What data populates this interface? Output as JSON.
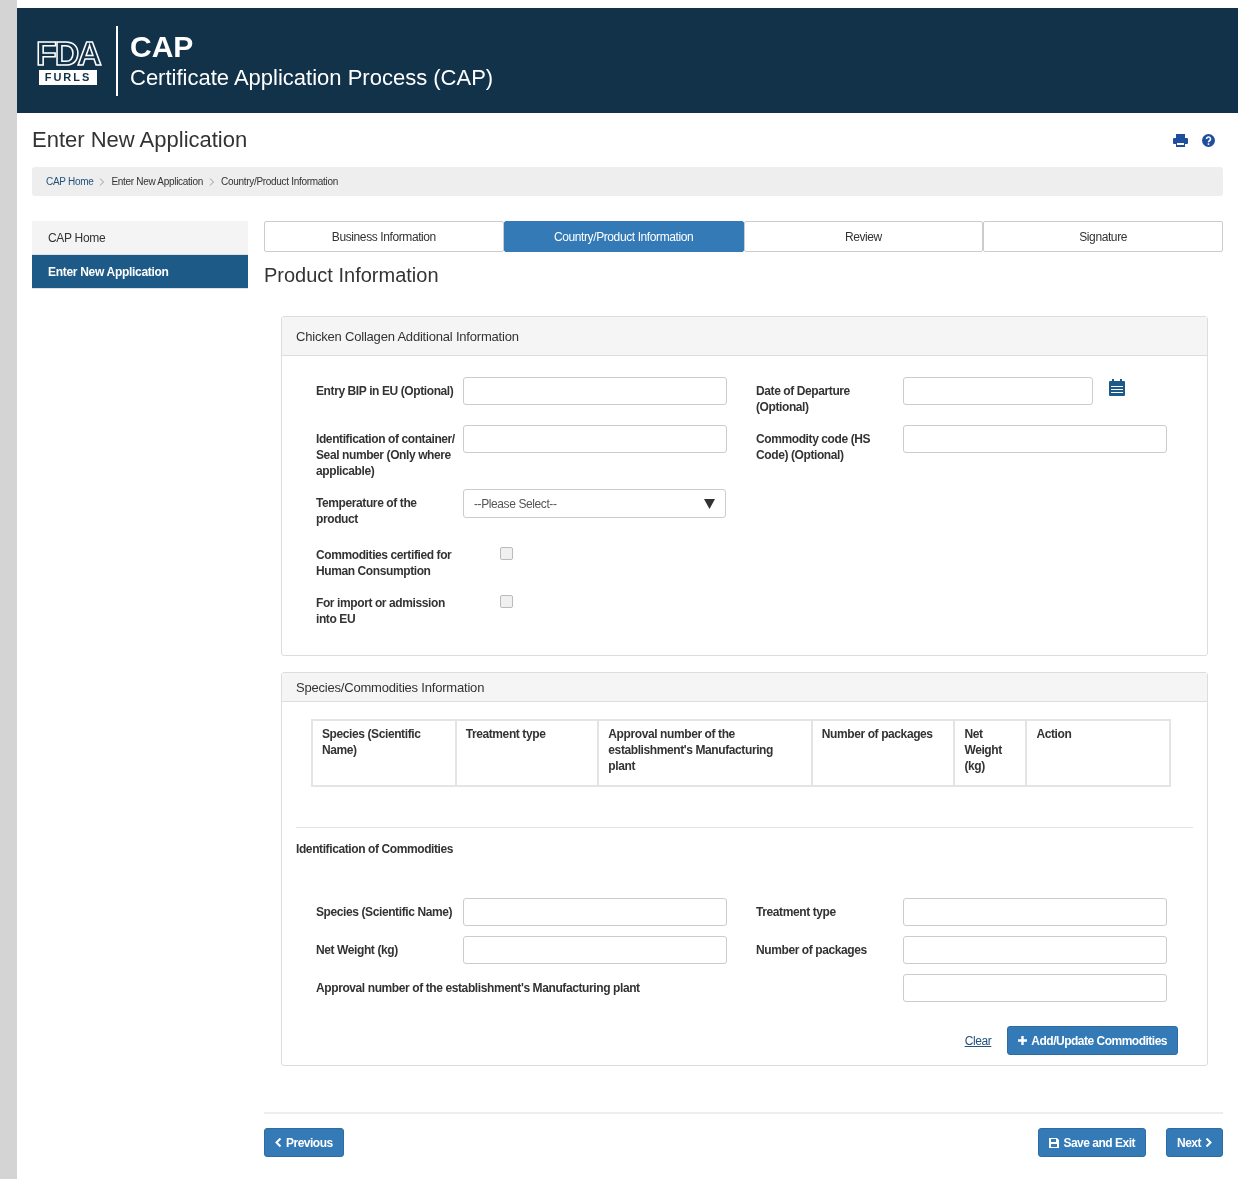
{
  "header": {
    "logo": {
      "top": "FDA",
      "bottom": "FURLS"
    },
    "title": "CAP",
    "subtitle": "Certificate Application Process (CAP)"
  },
  "page_title": "Enter New Application",
  "breadcrumb": [
    {
      "label": "CAP Home",
      "kind": "link"
    },
    {
      "label": "Enter New Application",
      "kind": "text"
    },
    {
      "label": "Country/Product Information",
      "kind": "text"
    }
  ],
  "sidebar": {
    "items": [
      {
        "label": "CAP Home",
        "selected": false
      },
      {
        "label": "Enter New Application",
        "selected": true
      }
    ]
  },
  "tabs": [
    {
      "label": "Business Information",
      "selected": false
    },
    {
      "label": "Country/Product Information",
      "selected": true
    },
    {
      "label": "Review",
      "selected": false
    },
    {
      "label": "Signature",
      "selected": false
    }
  ],
  "section_title": "Product Information",
  "additional_panel": {
    "title": "Chicken Collagen Additional Information",
    "rows": [
      [
        {
          "label": "Entry BIP in EU (Optional)",
          "kind": "text"
        },
        {
          "label": "Date of Departure (Optional)",
          "kind": "date"
        }
      ],
      [
        {
          "label": "Identification of container/  Seal number (Only where applicable)",
          "kind": "text"
        },
        {
          "label": "Commodity code (HS Code) (Optional)",
          "kind": "text"
        }
      ],
      [
        {
          "label": "Temperature of the product",
          "kind": "select",
          "value": "--Please Select--"
        }
      ],
      [
        {
          "label": "Commodities certified for Human Consumption",
          "kind": "checkbox",
          "checked": false
        }
      ],
      [
        {
          "label": "For import or admission into EU",
          "kind": "checkbox",
          "checked": false
        }
      ]
    ]
  },
  "commodities_panel": {
    "title": "Species/Commodities Information",
    "table": {
      "columns": [
        "Species (Scientific Name)",
        "Treatment type",
        "Approval number of the establishment's Manufacturing plant",
        "Number of packages",
        "Net Weight (kg)",
        "Action"
      ]
    },
    "subheading": "Identification of Commodities",
    "rows": [
      [
        {
          "label": "Species (Scientific Name)",
          "kind": "text"
        },
        {
          "label": "Treatment type",
          "kind": "text"
        }
      ],
      [
        {
          "label": "Net Weight (kg)",
          "kind": "text"
        },
        {
          "label": "Number of packages",
          "kind": "text"
        }
      ],
      [
        {
          "label": "Approval number of the establishment's Manufacturing plant",
          "kind": "wide"
        }
      ]
    ],
    "clear_link": "Clear",
    "add_button": "Add/Update Commodities"
  },
  "footer": {
    "previous": "Previous",
    "save": "Save and Exit",
    "next": "Next"
  }
}
